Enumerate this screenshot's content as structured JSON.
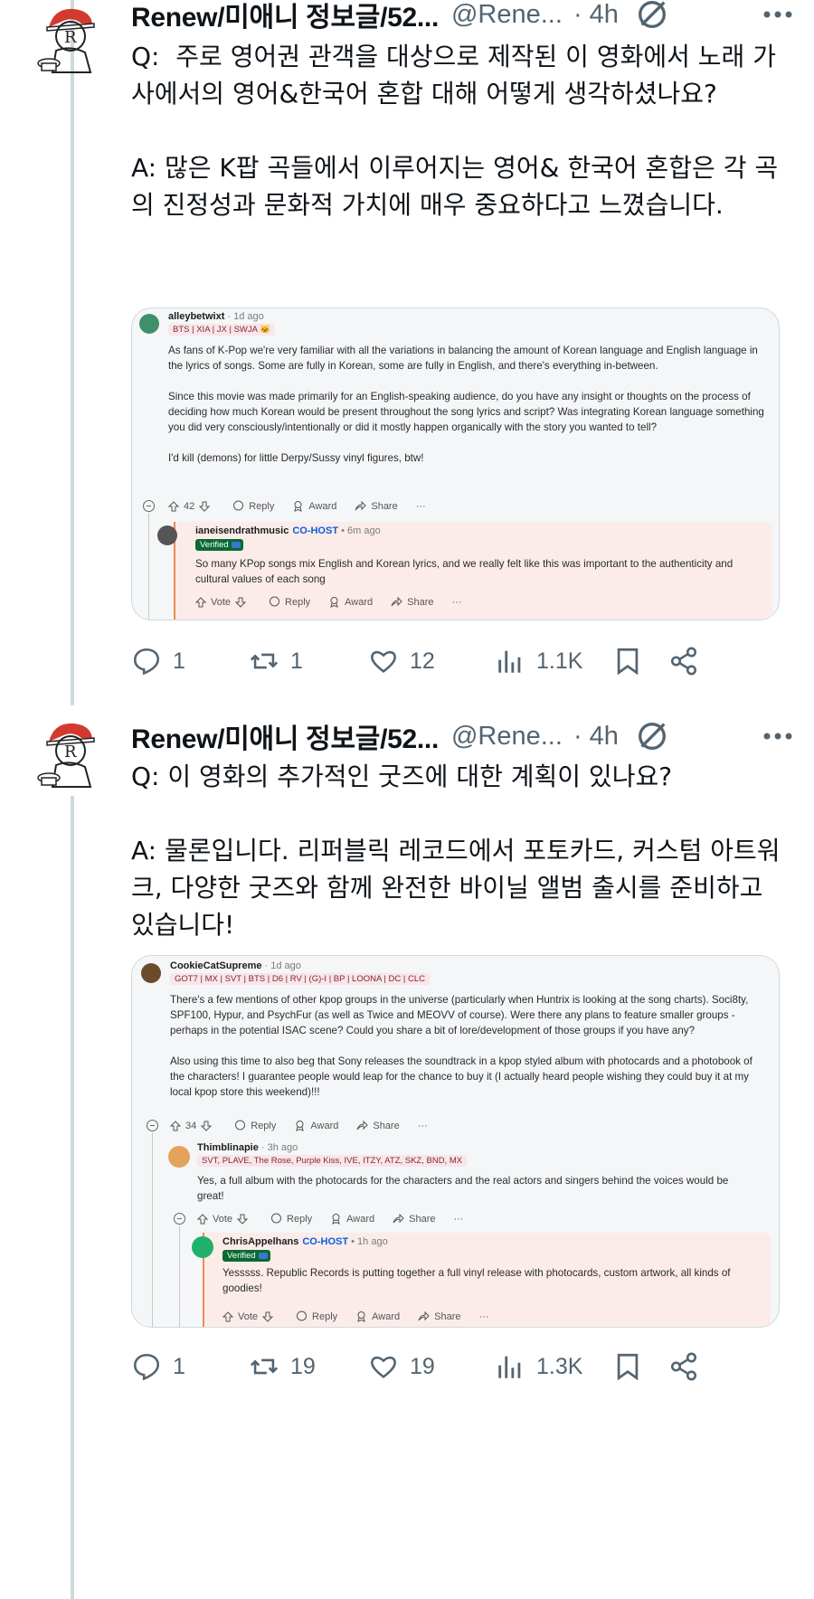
{
  "colors": {
    "text": "#0f1419",
    "secondary": "#536471",
    "thread_line": "#cfd9de",
    "cohost": "#0b5fdb",
    "flair": "#8a2432",
    "reply_bar": "#ed8a52"
  },
  "tweets": [
    {
      "author": "Renew/미애니 정보글/52...",
      "handle": "@Rene...",
      "time": "· 4h",
      "text": "Q:  주로 영어권 관객을 대상으로 제작된 이 영화에서 노래 가사에서의 영어&한국어 혼합 대해 어떻게 생각하셨나요?\n\nA: 많은 K팝 곡들에서 이루어지는 영어& 한국어 혼합은 각 곡의 진정성과 문화적 가치에 매우 중요하다고 느꼈습니다.",
      "card": {
        "comment": {
          "username": "alleybetwixt",
          "ago": " · 1d ago",
          "flair": "BTS | XIA | JX | SWJA 🐱",
          "text": "As fans of K-Pop we're very familiar with all the variations in balancing the amount of Korean language and English language in the lyrics of songs. Some are fully in Korean, some are fully in English, and there's everything in-between.\n\nSince this movie was made primarily for an English-speaking audience, do you have any insight or thoughts on the process of deciding how much Korean would be present throughout the song lyrics and script? Was integrating Korean language something you did very consciously/intentionally or did it mostly happen organically with the story you wanted to tell?\n\nI'd kill (demons) for little Derpy/Sussy vinyl figures, btw!",
          "votes": "42",
          "reply": "Reply",
          "award": "Award",
          "share": "Share",
          "more": "···"
        },
        "reply": {
          "username": "ianeisendrathmusic",
          "cohost": "CO-HOST",
          "ago": " • 6m ago",
          "verified": "Verified",
          "text": "So many KPop songs mix English and Korean lyrics, and we really felt like this was important to the authenticity and cultural values of each song",
          "votes": "Vote",
          "reply": "Reply",
          "award": "Award",
          "share": "Share",
          "more": "···"
        }
      },
      "stats": {
        "replies": "1",
        "retweets": "1",
        "likes": "12",
        "views": "1.1K"
      }
    },
    {
      "author": "Renew/미애니 정보글/52...",
      "handle": "@Rene...",
      "time": "· 4h",
      "text": "Q: 이 영화의 추가적인 굿즈에 대한 계획이 있나요?\n\nA: 물론입니다. 리퍼블릭 레코드에서 포토카드, 커스텀 아트워크, 다양한 굿즈와 함께 완전한 바이닐 앨범 출시를 준비하고 있습니다!",
      "card": {
        "comment": {
          "username": "CookieCatSupreme",
          "ago": " · 1d ago",
          "flair": "GOT7 | MX | SVT | BTS | D6 | RV | (G)-I | BP | LOONA | DC | CLC",
          "text": "There's a few mentions of other kpop groups in the universe (particularly when Huntrix is looking at the song charts). Soci8ty, SPF100, Hypur, and PsychFur (as well as Twice and MEOVV of course). Were there any plans to feature smaller groups - perhaps in the potential ISAC scene? Could you share a bit of lore/development of those groups if you have any?\n\nAlso using this time to also beg that Sony releases the soundtrack in a kpop styled album with photocards and a photobook of the characters! I guarantee people would leap for the chance to buy it (I actually heard people wishing they could buy it at my local kpop store this weekend)!!!",
          "votes": "34",
          "reply": "Reply",
          "award": "Award",
          "share": "Share",
          "more": "···"
        },
        "reply1": {
          "username": "Thimblinapie",
          "ago": " · 3h ago",
          "flair": "SVT, PLAVE, The Rose, Purple Kiss, IVE, ITZY, ATZ, SKZ, BND, MX",
          "text": "Yes, a full album with the photocards for the characters and the real actors and singers behind the voices would be great!",
          "votes": "Vote",
          "reply": "Reply",
          "award": "Award",
          "share": "Share",
          "more": "···"
        },
        "reply2": {
          "username": "ChrisAppelhans",
          "cohost": "CO-HOST",
          "ago": " • 1h ago",
          "verified": "Verified",
          "text": "Yesssss. Republic Records is putting together a full vinyl release with photocards, custom artwork, all kinds of goodies!",
          "votes": "Vote",
          "reply": "Reply",
          "award": "Award",
          "share": "Share",
          "more": "···"
        }
      },
      "stats": {
        "replies": "1",
        "retweets": "19",
        "likes": "19",
        "views": "1.3K"
      }
    }
  ]
}
